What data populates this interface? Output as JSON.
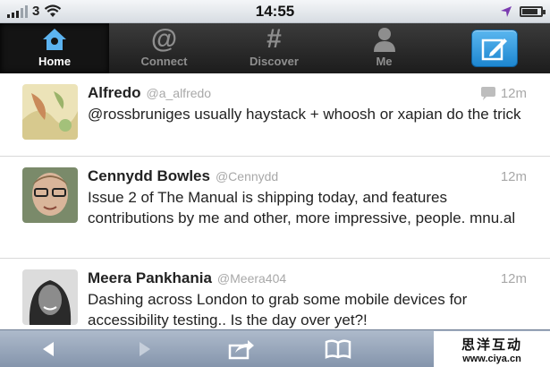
{
  "status_bar": {
    "carrier": "3",
    "time": "14:55",
    "battery_level": 0.85,
    "icons": [
      "signal-icon",
      "wifi-icon",
      "location-arrow-icon",
      "battery-icon"
    ]
  },
  "tab_bar": {
    "tabs": [
      {
        "label": "Home",
        "icon": "home-icon",
        "active": true
      },
      {
        "label": "Connect",
        "icon": "at-sign-icon",
        "active": false
      },
      {
        "label": "Discover",
        "icon": "hash-icon",
        "active": false
      },
      {
        "label": "Me",
        "icon": "person-icon",
        "active": false
      }
    ],
    "compose_icon": "compose-icon",
    "colors": {
      "accent": "#2a93dc",
      "bar": "#262626"
    }
  },
  "timeline": {
    "tweets": [
      {
        "name": "Alfredo",
        "handle": "@a_alfredo",
        "time": "12m",
        "has_reply_icon": true,
        "text": "@rossbruniges usually haystack + whoosh or xapian do the trick"
      },
      {
        "name": "Cennydd Bowles",
        "handle": "@Cennydd",
        "time": "12m",
        "has_reply_icon": false,
        "text": "Issue 2 of The Manual is shipping today, and features contributions by me and other, more impressive, people. mnu.al"
      },
      {
        "name": "Meera Pankhania",
        "handle": "@Meera404",
        "time": "12m",
        "has_reply_icon": false,
        "text": "Dashing across London to grab some mobile devices for accessibility testing.. Is the day over yet?!"
      }
    ]
  },
  "toolbar": {
    "buttons": [
      "back-arrow-icon",
      "forward-arrow-icon",
      "share-icon",
      "bookmarks-icon"
    ]
  },
  "watermark": {
    "chinese": "思洋互动",
    "url": "www.ciya.cn"
  }
}
